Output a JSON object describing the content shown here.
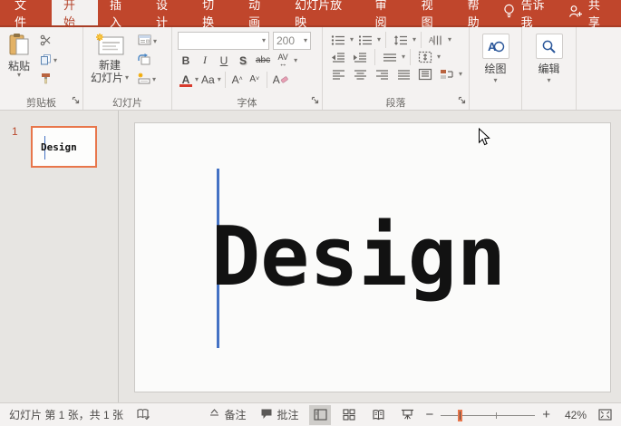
{
  "titlebar": {
    "tabs": [
      {
        "label": "文件"
      },
      {
        "label": "开始"
      },
      {
        "label": "插入"
      },
      {
        "label": "设计"
      },
      {
        "label": "切换"
      },
      {
        "label": "动画"
      },
      {
        "label": "幻灯片放映"
      },
      {
        "label": "审阅"
      },
      {
        "label": "视图"
      },
      {
        "label": "帮助"
      }
    ],
    "active_tab": "开始",
    "tell_me": "告诉我",
    "share": "共享"
  },
  "ribbon": {
    "clipboard": {
      "paste": "粘贴",
      "label": "剪贴板"
    },
    "slides": {
      "new_slide_line1": "新建",
      "new_slide_line2": "幻灯片",
      "label": "幻灯片"
    },
    "font": {
      "name_value": "",
      "size_value": "200",
      "bold": "B",
      "italic": "I",
      "underline": "U",
      "shadow": "S",
      "strikethrough": "abc",
      "char_spacing": "AV",
      "font_color": "A",
      "change_case": "Aa",
      "grow_font": "A",
      "shrink_font": "A",
      "clear_format": "A",
      "label": "字体"
    },
    "paragraph": {
      "label": "段落"
    },
    "drawing": {
      "button": "绘图"
    },
    "editing": {
      "button": "编辑"
    }
  },
  "slide_panel": {
    "slide_number": "1",
    "thumbnail_text": "Design"
  },
  "slide": {
    "text": "Design"
  },
  "statusbar": {
    "slide_info": "幻灯片 第 1 张，共 1 张",
    "notes": "备注",
    "comments": "批注",
    "zoom_minus": "−",
    "zoom_plus": "+",
    "zoom_level": "42%"
  },
  "icons": {
    "dropdown": "▾",
    "arrow_up": "˄",
    "arrow_down": "˅"
  },
  "colors": {
    "accent_red": "#C0462C",
    "selection_orange": "#E8764B",
    "caret_blue": "#4472C4"
  }
}
